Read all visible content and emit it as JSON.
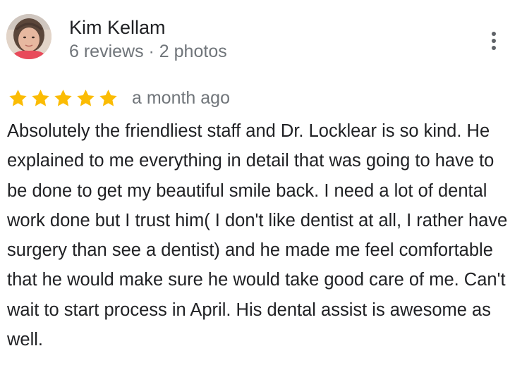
{
  "review": {
    "author": {
      "name": "Kim Kellam",
      "meta": "6 reviews · 2 photos"
    },
    "rating": 5,
    "rating_max": 5,
    "date": "a month ago",
    "text": "Absolutely the friendliest staff and Dr. Locklear is so kind. He explained to me everything in detail that was going to have to be done to get my beautiful smile back. I need a lot of dental work done but I trust him( I don't like dentist at all, I rather have surgery than see a dentist) and he made me feel comfortable that he would make sure he would take good care of me. Can't wait to start process in April. His dental assist is awesome as well."
  },
  "icons": {
    "avatar": "user-photo",
    "more": "more-vert-icon",
    "star": "star-icon"
  },
  "colors": {
    "star": "#fbbc04",
    "name": "#202124",
    "secondary": "#70757a"
  }
}
